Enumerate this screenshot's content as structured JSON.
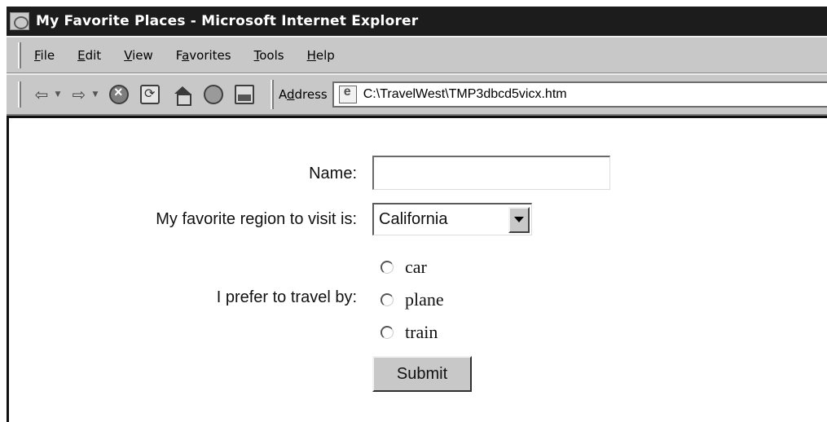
{
  "window": {
    "title": "My Favorite Places - Microsoft Internet Explorer"
  },
  "menu": [
    {
      "pre": "",
      "acc": "F",
      "post": "ile"
    },
    {
      "pre": "",
      "acc": "E",
      "post": "dit"
    },
    {
      "pre": "",
      "acc": "V",
      "post": "iew"
    },
    {
      "pre": "F",
      "acc": "a",
      "post": "vorites"
    },
    {
      "pre": "",
      "acc": "T",
      "post": "ools"
    },
    {
      "pre": "",
      "acc": "H",
      "post": "elp"
    }
  ],
  "toolbar": {
    "back_icon": "back-arrow",
    "forward_icon": "forward-arrow",
    "icons": [
      "stop-icon",
      "refresh-icon",
      "home-icon",
      "search-icon",
      "print-icon"
    ],
    "address_pre": "A",
    "address_acc": "d",
    "address_post": "dress",
    "address_value": "C:\\TravelWest\\TMP3dbcd5vicx.htm"
  },
  "form": {
    "name_label": "Name:",
    "name_value": "",
    "region_label": "My favorite region to visit is:",
    "region_selected": "California",
    "travel_label": "I prefer to travel by:",
    "travel_options": [
      "car",
      "plane",
      "train"
    ],
    "submit_label": "Submit"
  }
}
